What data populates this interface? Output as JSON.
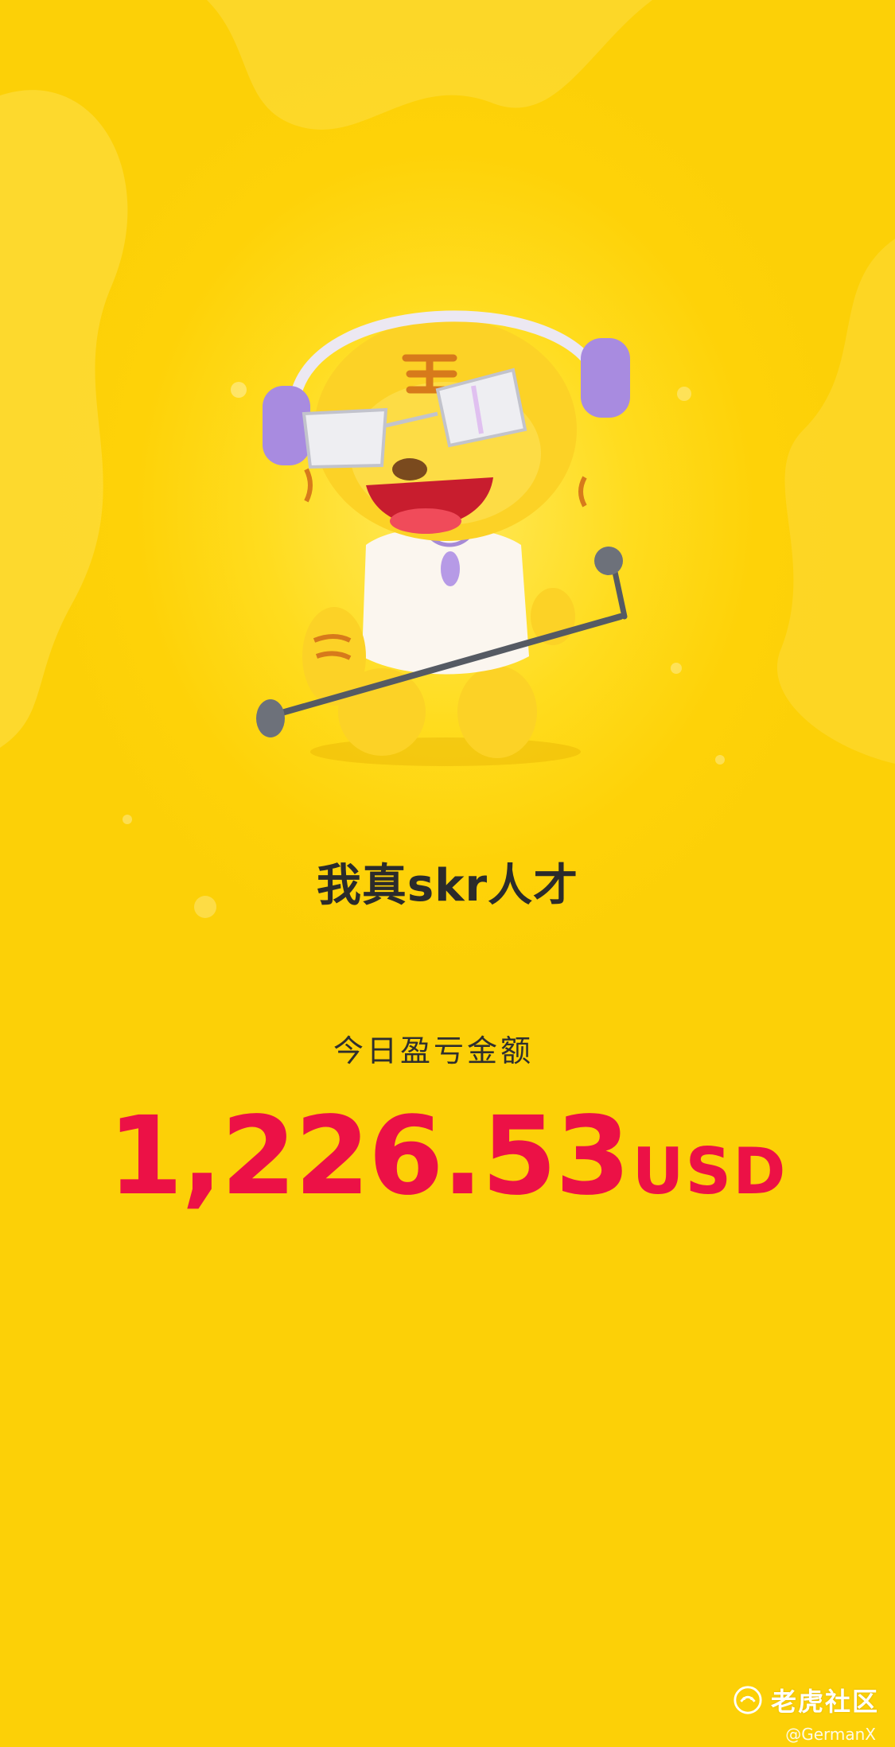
{
  "colors": {
    "background": "#fdd514",
    "amount": "#ec1146",
    "text": "#2b2b2b"
  },
  "mascot": {
    "icon": "tiger-singer-mascot"
  },
  "slogan": "我真skr人才",
  "pnl": {
    "label": "今日盈亏金额",
    "value": "1,226.53",
    "currency": "USD"
  },
  "watermark": {
    "icon": "tiger-community-logo-icon",
    "name": "老虎社区",
    "handle": "@GermanX"
  }
}
